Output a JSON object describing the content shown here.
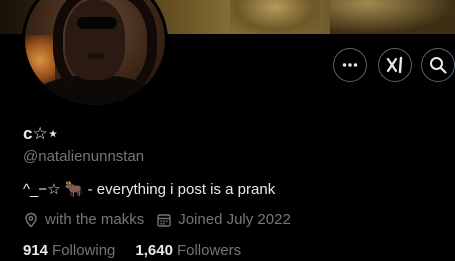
{
  "profile": {
    "display_name": "c☆⋆",
    "handle": "@natalienunnstan",
    "bio": "^_−☆ 🐂 - everything i post is a prank",
    "location": "with the makks",
    "joined": "Joined July 2022",
    "following_count": "914",
    "following_label": "Following",
    "followers_count": "1,640",
    "followers_label": "Followers"
  },
  "actions": [
    {
      "icon": "more-icon"
    },
    {
      "icon": "grok-icon"
    },
    {
      "icon": "search-icon"
    }
  ],
  "colors": {
    "background": "#000000",
    "text_primary": "#e7e9ea",
    "text_secondary": "#71767b",
    "button_border": "#536471"
  }
}
